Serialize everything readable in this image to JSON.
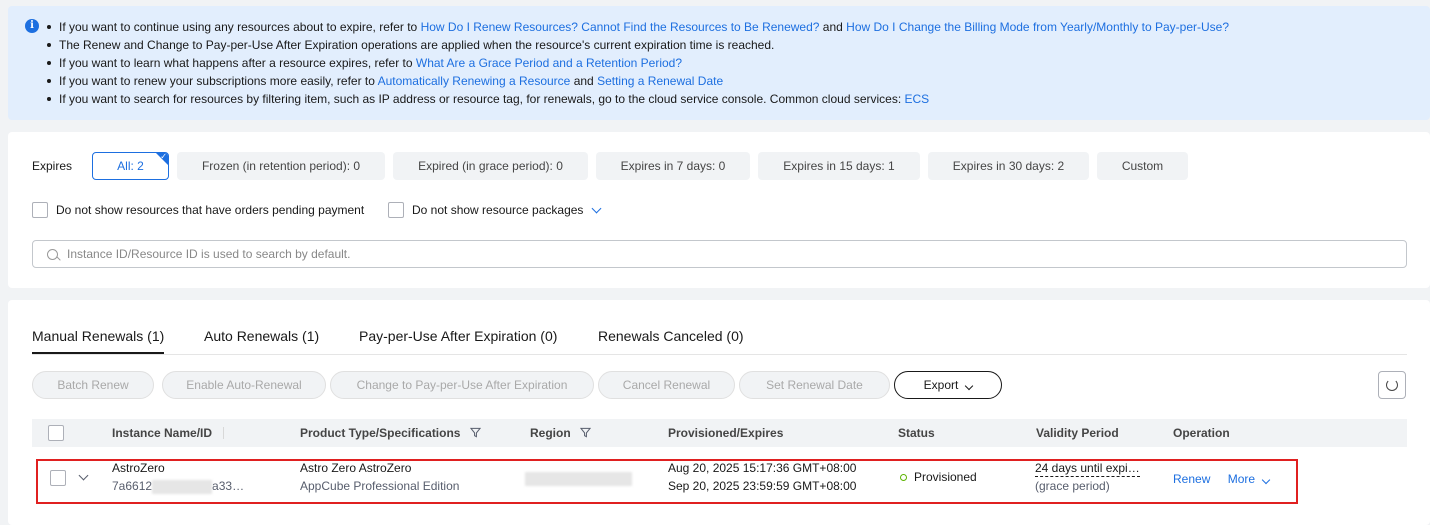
{
  "notice": {
    "line1_text": "If you want to continue using any resources about to expire, refer to",
    "line1_link1": "How Do I Renew Resources? Cannot Find the Resources to Be Renewed?",
    "line1_and": "and",
    "line1_link2": "How Do I Change the Billing Mode from Yearly/Monthly to Pay-per-Use?",
    "line2_text": "The Renew and Change to Pay-per-Use After Expiration operations are applied when the resource's current expiration time is reached.",
    "line3_text": "If you want to learn what happens after a resource expires, refer to",
    "line3_link": "What Are a Grace Period and a Retention Period?",
    "line4_text": "If you want to renew your subscriptions more easily, refer to",
    "line4_link1": "Automatically Renewing a Resource",
    "line4_and": "and",
    "line4_link2": "Setting a Renewal Date",
    "line5_text": "If you want to search for resources by filtering item, such as IP address or resource tag, for renewals, go to the cloud service console. Common cloud services:",
    "line5_link": "ECS"
  },
  "filters": {
    "expires_label": "Expires",
    "chips": [
      "All: 2",
      "Frozen (in retention period): 0",
      "Expired (in grace period): 0",
      "Expires in 7 days: 0",
      "Expires in 15 days: 1",
      "Expires in 30 days: 2",
      "Custom"
    ],
    "selected_chip": "All: 2",
    "checkbox_pending": "Do not show resources that have orders pending payment",
    "checkbox_packages": "Do not show resource packages",
    "search_placeholder": "Instance ID/Resource ID is used to search by default."
  },
  "tabs": [
    "Manual Renewals (1)",
    "Auto Renewals (1)",
    "Pay-per-Use After Expiration (0)",
    "Renewals Canceled (0)"
  ],
  "active_tab": "Manual Renewals (1)",
  "actions": {
    "batch_renew": "Batch Renew",
    "enable_auto_renewal": "Enable Auto-Renewal",
    "change_ppu": "Change to Pay-per-Use After Expiration",
    "cancel_renewal": "Cancel Renewal",
    "set_renewal_date": "Set Renewal Date",
    "export": "Export"
  },
  "table": {
    "headers": {
      "instance": "Instance Name/ID",
      "product": "Product Type/Specifications",
      "region": "Region",
      "provisioned": "Provisioned/Expires",
      "status": "Status",
      "validity": "Validity Period",
      "operation": "Operation"
    },
    "rows": [
      {
        "name": "AstroZero",
        "id_prefix": "7a6612",
        "id_suffix": "a33…",
        "product_type": "Astro Zero AstroZero",
        "product_spec": "AppCube Professional Edition",
        "provisioned": "Aug 20, 2025 15:17:36 GMT+08:00",
        "expires": "Sep 20, 2025 23:59:59 GMT+08:00",
        "status": "Provisioned",
        "validity": "24 days until expi…",
        "validity_note": "(grace period)",
        "op_renew": "Renew",
        "op_more": "More"
      }
    ]
  },
  "colors": {
    "accent": "#1d6fe0",
    "status_ok": "#5cb300",
    "highlight": "#e02020"
  }
}
